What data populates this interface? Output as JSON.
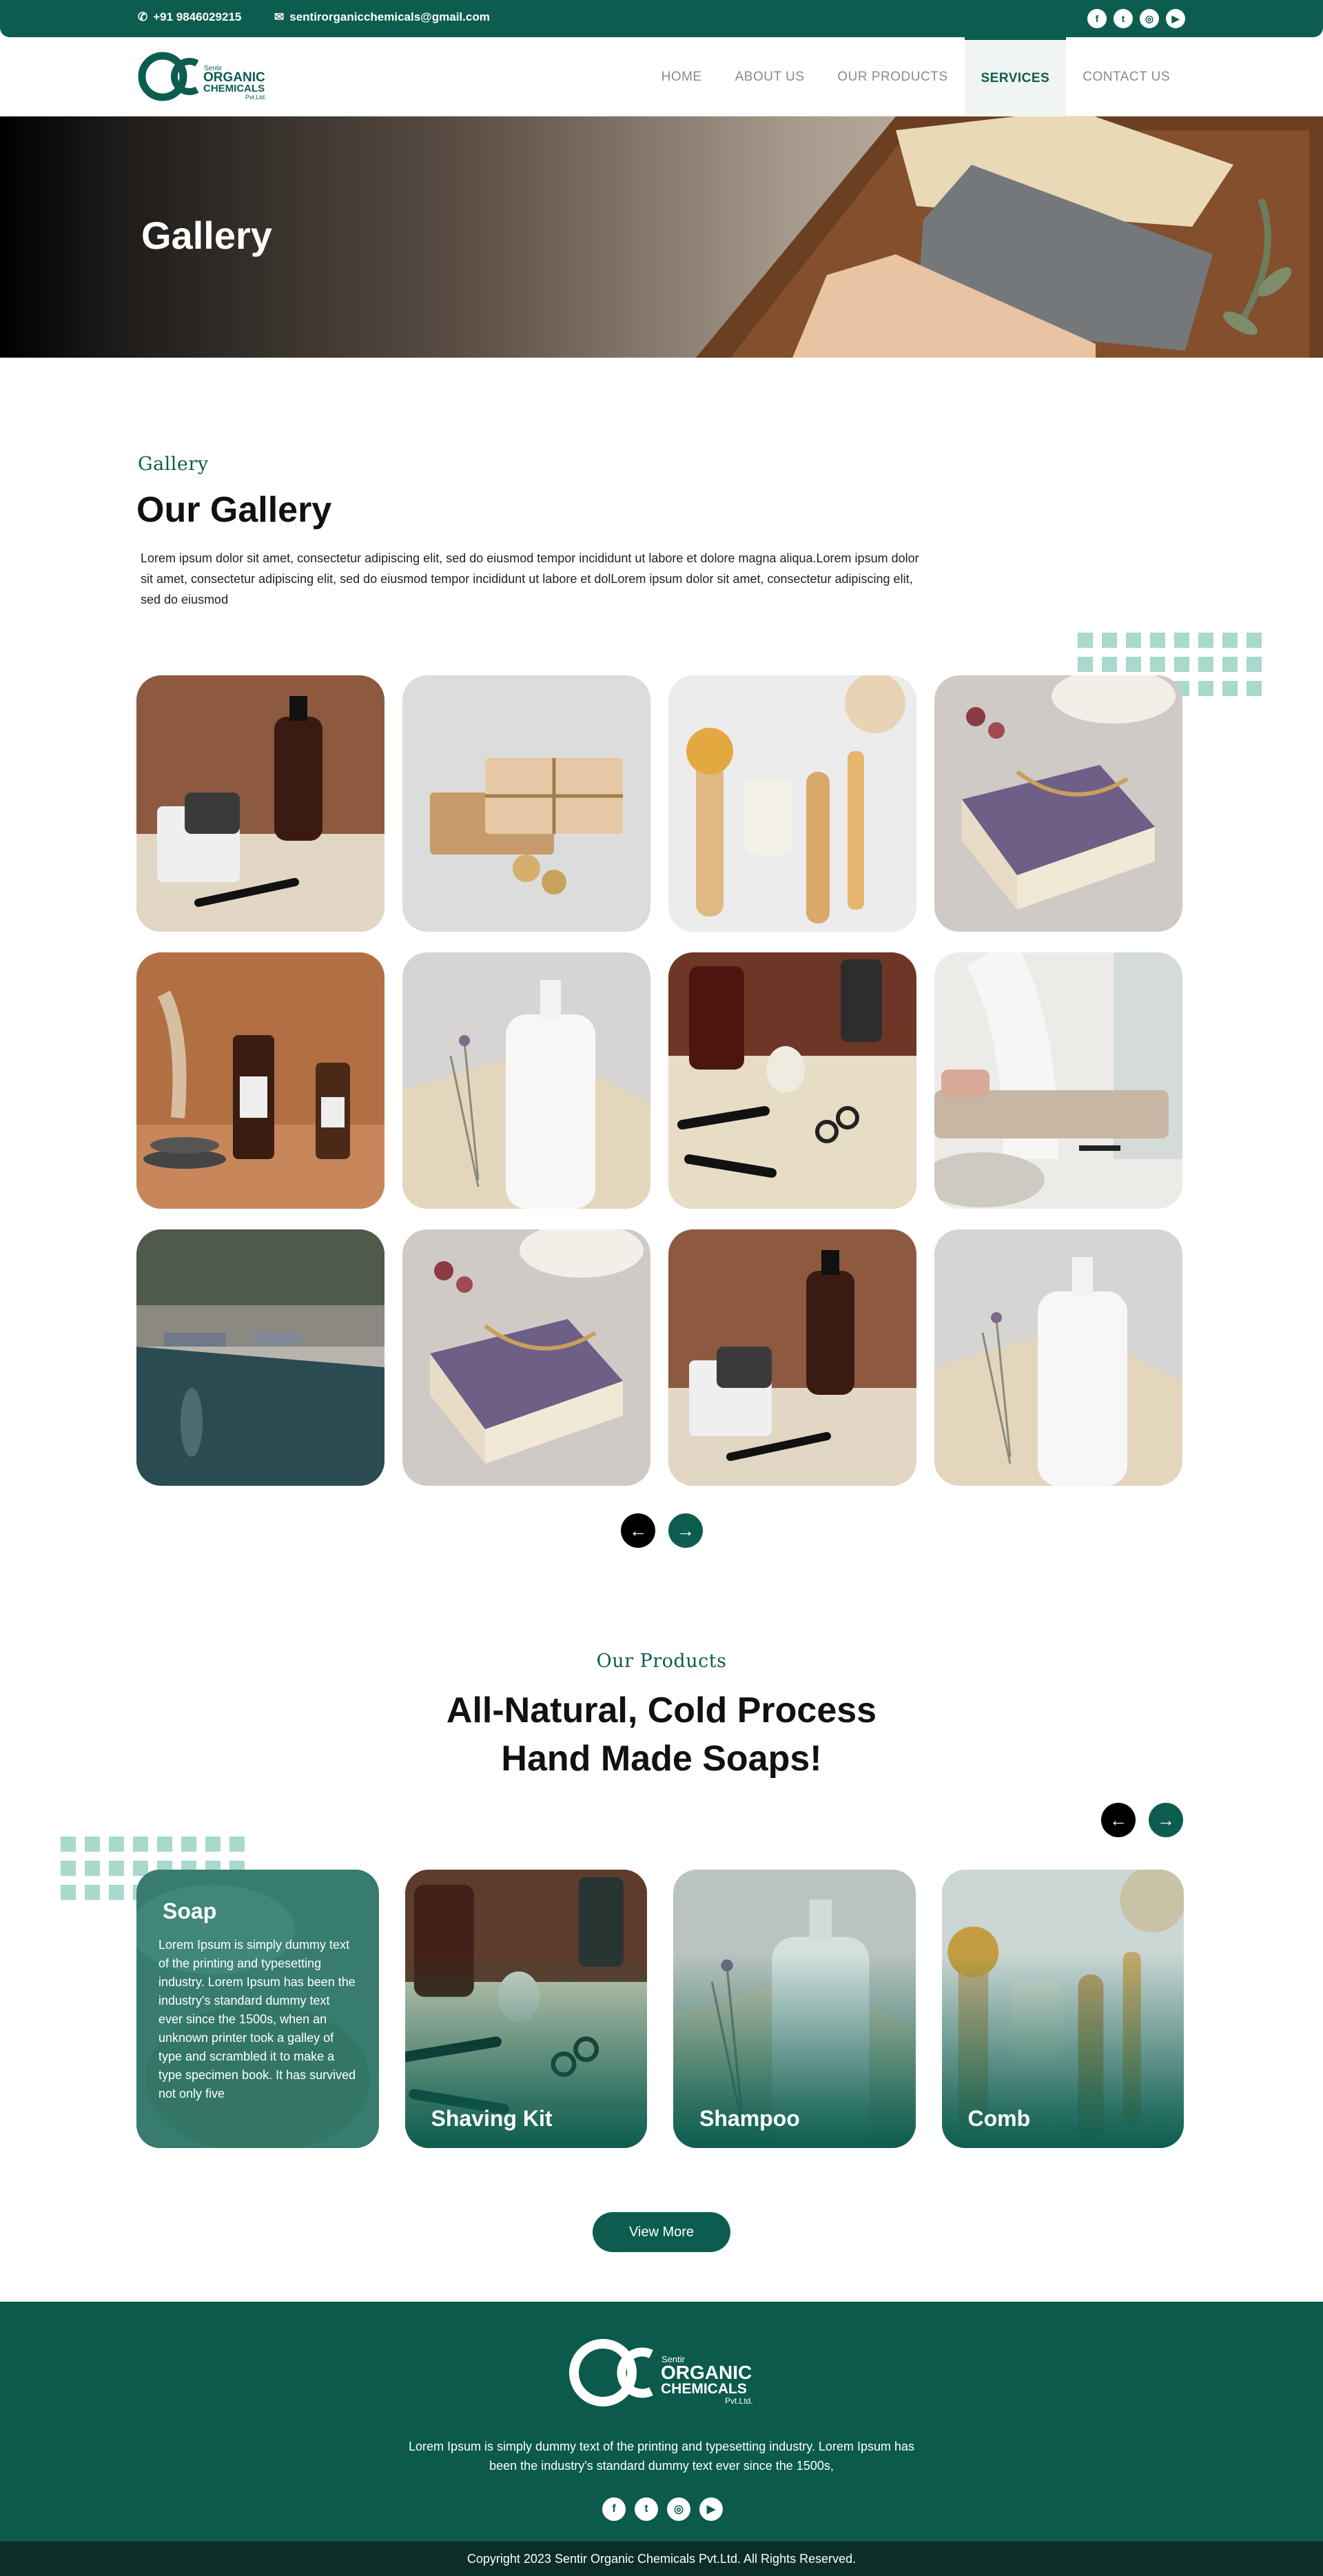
{
  "topbar": {
    "phone": "+91 9846029215",
    "email": "sentirorganicchemicals@gmail.com",
    "social": [
      {
        "icon": "facebook-icon",
        "glyph": "f"
      },
      {
        "icon": "twitter-icon",
        "glyph": "t"
      },
      {
        "icon": "instagram-icon",
        "glyph": "◎"
      },
      {
        "icon": "youtube-icon",
        "glyph": "▶"
      }
    ]
  },
  "brand": {
    "line1": "Sentir",
    "line2": "ORGANIC",
    "line3": "CHEMICALS",
    "line4": "Pvt.Ltd."
  },
  "nav": [
    {
      "label": "HOME",
      "active": false
    },
    {
      "label": "ABOUT US",
      "active": false
    },
    {
      "label": "OUR PRODUCTS",
      "active": false
    },
    {
      "label": "SERVICES",
      "active": true
    },
    {
      "label": "CONTACT US",
      "active": false
    }
  ],
  "banner": {
    "title": "Gallery"
  },
  "gallery_section": {
    "eyebrow": "Gallery",
    "title": "Our Gallery",
    "description": "Lorem ipsum dolor sit amet, consectetur adipiscing elit, sed do eiusmod tempor incididunt ut labore et dolore magna aliqua.Lorem ipsum dolor sit amet, consectetur adipiscing elit, sed do eiusmod tempor incididunt ut labore et dolLorem ipsum dolor sit amet, consectetur adipiscing elit, sed do eiusmod",
    "images": [
      "razor-kit",
      "wrapped-soap",
      "brushes",
      "soap-bar",
      "serum-bottles",
      "white-bottle",
      "shaving-tools",
      "bedroom",
      "pool",
      "soap-bar",
      "razor-kit",
      "white-bottle"
    ],
    "prev": "←",
    "next": "→"
  },
  "products_section": {
    "eyebrow": "Our Products",
    "title_line1": "All-Natural, Cold Process",
    "title_line2": "Hand Made Soaps!",
    "prev": "←",
    "next": "→",
    "items": [
      {
        "title": "Soap",
        "image": "soap-plate",
        "description": "Lorem Ipsum is simply dummy text of the printing and typesetting industry. Lorem Ipsum has been the industry's standard dummy text ever since the 1500s, when an unknown printer took a galley of type and scrambled it to make a type specimen book. It has survived not only five"
      },
      {
        "title": "Shaving Kit",
        "image": "shaving-tools",
        "description": ""
      },
      {
        "title": "Shampoo",
        "image": "white-bottle",
        "description": ""
      },
      {
        "title": "Comb",
        "image": "brushes",
        "description": ""
      }
    ],
    "view_more": "View More"
  },
  "footer": {
    "text": "Lorem Ipsum is simply dummy text of the printing and typesetting industry. Lorem Ipsum has been the industry's standard dummy text ever since the 1500s,",
    "copyright": "Copyright 2023 Sentir Organic Chemicals Pvt.Ltd. All Rights Reserved."
  },
  "colors": {
    "primary": "#0c5d4f",
    "accent_light": "#a9d8cd",
    "dark_footer": "#0c2e28"
  }
}
